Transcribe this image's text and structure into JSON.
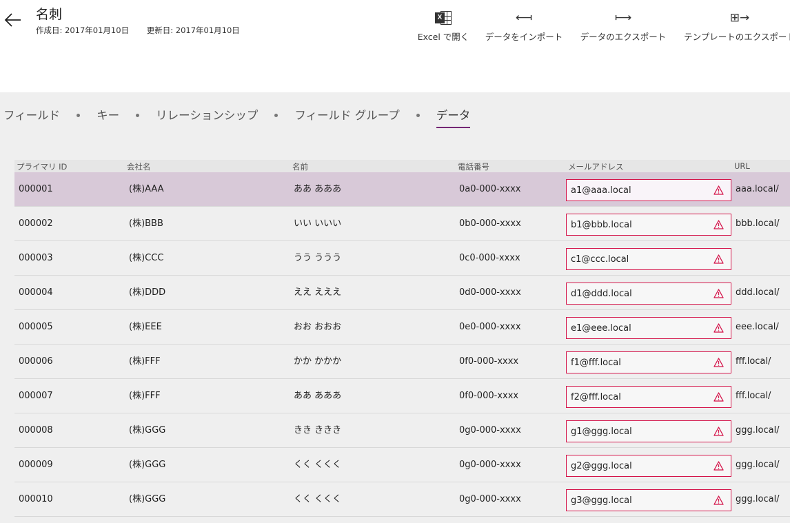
{
  "header": {
    "title": "名刺",
    "created": "作成日: 2017年01月10日",
    "updated": "更新日: 2017年01月10日"
  },
  "commands": {
    "excel": "Excel で開く",
    "import": "データをインポート",
    "export": "データのエクスポート",
    "template": "テンプレートのエクスポート"
  },
  "tabs": [
    "フィールド",
    "キー",
    "リレーションシップ",
    "フィールド グループ",
    "データ"
  ],
  "active_tab": "データ",
  "table": {
    "columns": [
      "プライマリ ID",
      "会社名",
      "名前",
      "電話番号",
      "メールアドレス",
      "URL"
    ],
    "rows": [
      {
        "id": "000001",
        "company": "(株)AAA",
        "name": "ああ あああ",
        "phone": "0a0-000-xxxx",
        "email": "a1@aaa.local",
        "url": "aaa.local/"
      },
      {
        "id": "000002",
        "company": "(株)BBB",
        "name": "いい いいい",
        "phone": "0b0-000-xxxx",
        "email": "b1@bbb.local",
        "url": "bbb.local/"
      },
      {
        "id": "000003",
        "company": "(株)CCC",
        "name": "うう ううう",
        "phone": "0c0-000-xxxx",
        "email": "c1@ccc.local",
        "url": ""
      },
      {
        "id": "000004",
        "company": "(株)DDD",
        "name": "ええ えええ",
        "phone": "0d0-000-xxxx",
        "email": "d1@ddd.local",
        "url": "ddd.local/"
      },
      {
        "id": "000005",
        "company": "(株)EEE",
        "name": "おお おおお",
        "phone": "0e0-000-xxxx",
        "email": "e1@eee.local",
        "url": "eee.local/"
      },
      {
        "id": "000006",
        "company": "(株)FFF",
        "name": "かか かかか",
        "phone": "0f0-000-xxxx",
        "email": "f1@fff.local",
        "url": "fff.local/"
      },
      {
        "id": "000007",
        "company": "(株)FFF",
        "name": "ああ あああ",
        "phone": "0f0-000-xxxx",
        "email": "f2@fff.local",
        "url": "fff.local/"
      },
      {
        "id": "000008",
        "company": "(株)GGG",
        "name": "きき ききき",
        "phone": "0g0-000-xxxx",
        "email": "g1@ggg.local",
        "url": "ggg.local/"
      },
      {
        "id": "000009",
        "company": "(株)GGG",
        "name": "くく くくく",
        "phone": "0g0-000-xxxx",
        "email": "g2@ggg.local",
        "url": "ggg.local/"
      },
      {
        "id": "000010",
        "company": "(株)GGG",
        "name": "くく くくく",
        "phone": "0g0-000-xxxx",
        "email": "g3@ggg.local",
        "url": "ggg.local/"
      }
    ],
    "selected_row": "000001"
  },
  "colors": {
    "accent": "#742774",
    "selected_row": "#d8c9d8",
    "error": "#d4144a"
  }
}
